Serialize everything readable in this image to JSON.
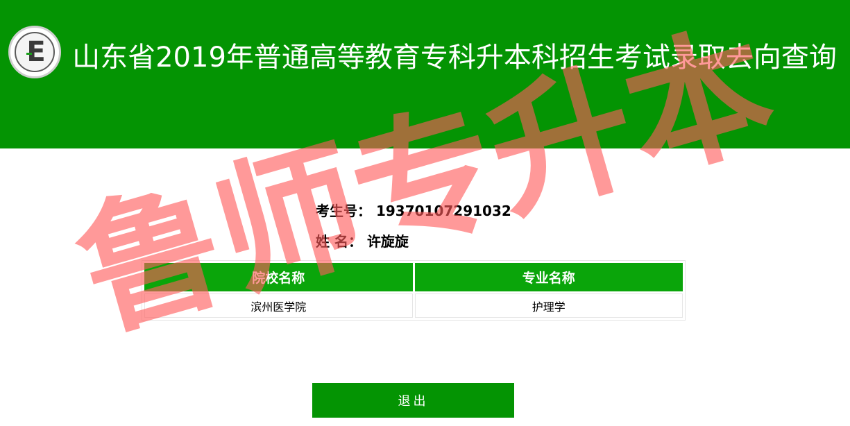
{
  "header": {
    "title": "山东省2019年普通高等教育专科升本科招生考试录取去向查询",
    "logo_letter": "E",
    "bg_color": "#049403"
  },
  "student": {
    "exam_no_label": "考生号：",
    "exam_no": "19370107291032",
    "name_label": "姓 名：",
    "name": "许旋旋"
  },
  "result_table": {
    "headers": [
      "院校名称",
      "专业名称"
    ],
    "rows": [
      [
        "滨州医学院",
        "护理学"
      ]
    ],
    "header_color": "#0aa50a"
  },
  "exit_button": {
    "label": "退出"
  },
  "watermark": {
    "text": "鲁师专升本",
    "color": "#ff6b6b"
  }
}
